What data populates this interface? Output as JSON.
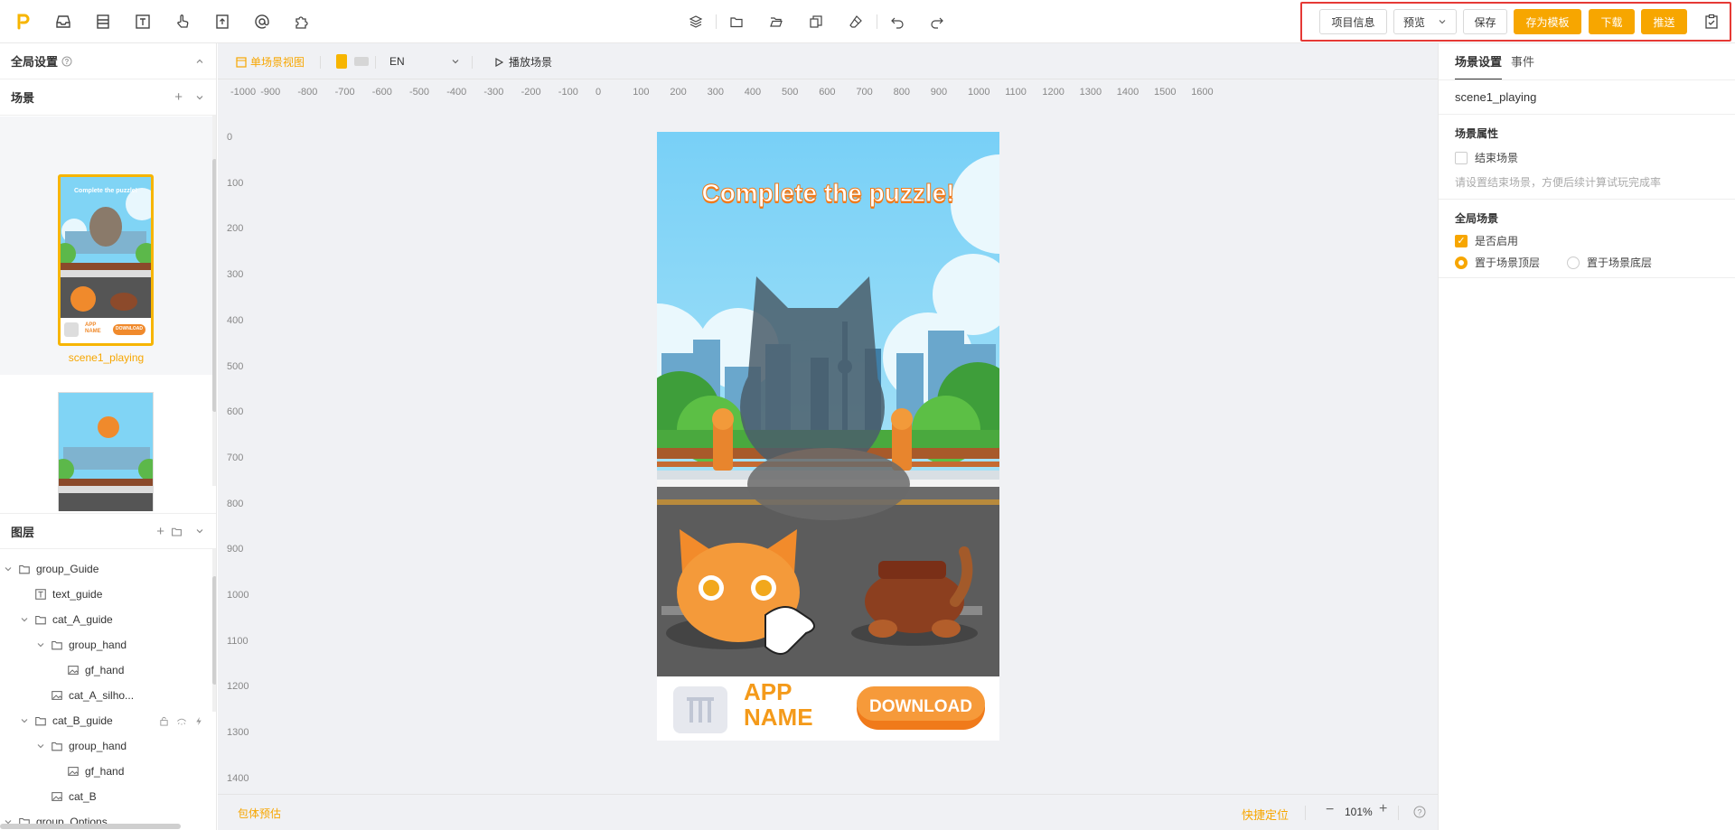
{
  "topbar": {
    "tools_left": [
      "brand-logo-icon",
      "inbox-icon",
      "layout-icon",
      "text-icon",
      "hand-icon",
      "upload-file-icon",
      "at-icon",
      "plugin-icon"
    ],
    "tools_center": [
      "layers-icon",
      "folder-icon",
      "folder-open-icon",
      "copy-icon",
      "eraser-icon",
      "undo-icon",
      "redo-icon"
    ],
    "project_info": "项目信息",
    "preview": "预览",
    "save": "保存",
    "save_template": "存为模板",
    "download": "下载",
    "push": "推送"
  },
  "left": {
    "global_settings": "全局设置",
    "scenes_title": "场景",
    "scene1_name": "scene1_playing",
    "layers_title": "图层",
    "layers": [
      {
        "name": "group_Guide",
        "type": "folder"
      },
      {
        "name": "text_guide",
        "type": "text"
      },
      {
        "name": "cat_A_guide",
        "type": "folder"
      },
      {
        "name": "group_hand",
        "type": "folder"
      },
      {
        "name": "gf_hand",
        "type": "image"
      },
      {
        "name": "cat_A_silho...",
        "type": "image"
      },
      {
        "name": "cat_B_guide",
        "type": "folder"
      },
      {
        "name": "group_hand",
        "type": "folder"
      },
      {
        "name": "gf_hand",
        "type": "image"
      },
      {
        "name": "cat_B",
        "type": "image"
      },
      {
        "name": "group_Options",
        "type": "folder"
      }
    ]
  },
  "canvas": {
    "view_mode": "单场景视图",
    "language": "EN",
    "play_scene": "播放场景",
    "ruler_x": [
      "-1000",
      "-900",
      "-800",
      "-700",
      "-600",
      "-500",
      "-400",
      "-300",
      "-200",
      "-100",
      "0",
      "100",
      "200",
      "300",
      "400",
      "500",
      "600",
      "700",
      "800",
      "900",
      "1000",
      "1100",
      "1200",
      "1300",
      "1400",
      "1500",
      "1600"
    ],
    "ruler_y": [
      "0",
      "100",
      "200",
      "300",
      "400",
      "500",
      "600",
      "700",
      "800",
      "900",
      "1000",
      "1100",
      "1200",
      "1300",
      "1400"
    ],
    "puzzle_title": "Complete the puzzle!",
    "app_name_line1": "APP",
    "app_name_line2": "NAME",
    "download_cta": "DOWNLOAD",
    "thumb_title": "Complete the puzzle!",
    "thumb_app": "APP",
    "thumb_name": "NAME",
    "thumb_dl": "DOWNLOAD"
  },
  "status": {
    "package_estimate": "包体预估",
    "quick_locate": "快捷定位",
    "zoom": "101%"
  },
  "right": {
    "tab_scene": "场景设置",
    "tab_events": "事件",
    "scene_name": "scene1_playing",
    "scene_props": "场景属性",
    "end_scene": "结束场景",
    "end_scene_hint": "请设置结束场景，方便后续计算试玩完成率",
    "global_scene": "全局场景",
    "enabled": "是否启用",
    "place_top": "置于场景顶层",
    "place_bottom": "置于场景底层"
  },
  "colors": {
    "accent": "#f7a600",
    "highlight": "#e53935"
  }
}
